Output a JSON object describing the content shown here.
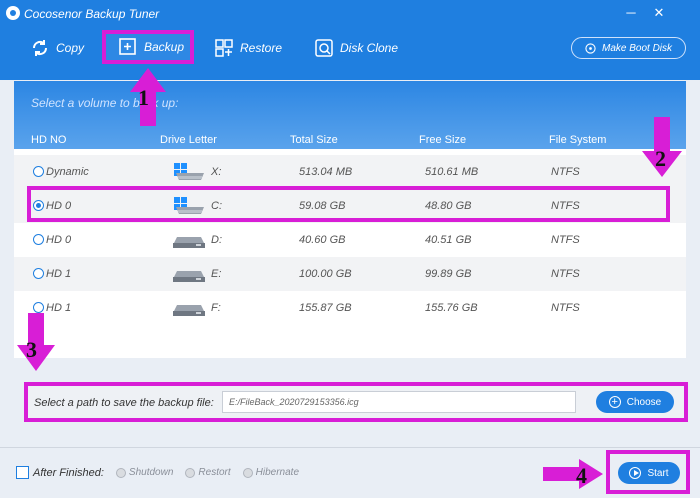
{
  "window": {
    "title": "Cocosenor Backup Tuner"
  },
  "toolbar": {
    "copy": "Copy",
    "backup": "Backup",
    "restore": "Restore",
    "disk_clone": "Disk Clone",
    "make_boot_disk": "Make Boot Disk"
  },
  "panel": {
    "hint": "Select a volume to back up:",
    "columns": [
      "HD NO",
      "Drive Letter",
      "Total Size",
      "Free Size",
      "File System"
    ],
    "rows": [
      {
        "hd": "Dynamic",
        "letter": "X:",
        "total": "513.04 MB",
        "free": "510.61 MB",
        "fs": "NTFS",
        "selected": false,
        "icon": "windows-drive-icon"
      },
      {
        "hd": "HD 0",
        "letter": "C:",
        "total": "59.08 GB",
        "free": "48.80 GB",
        "fs": "NTFS",
        "selected": true,
        "icon": "windows-drive-icon"
      },
      {
        "hd": "HD 0",
        "letter": "D:",
        "total": "40.60 GB",
        "free": "40.51 GB",
        "fs": "NTFS",
        "selected": false,
        "icon": "drive-icon"
      },
      {
        "hd": "HD 1",
        "letter": "E:",
        "total": "100.00 GB",
        "free": "99.89 GB",
        "fs": "NTFS",
        "selected": false,
        "icon": "drive-icon"
      },
      {
        "hd": "HD 1",
        "letter": "F:",
        "total": "155.87 GB",
        "free": "155.76 GB",
        "fs": "NTFS",
        "selected": false,
        "icon": "drive-icon"
      }
    ]
  },
  "path": {
    "label": "Select a path to save the backup file:",
    "value": "E:/FileBack_2020729153356.icg",
    "choose": "Choose"
  },
  "bottom": {
    "after_finished": "After Finished:",
    "options": [
      "Shutdown",
      "Restort",
      "Hibernate"
    ],
    "start": "Start"
  },
  "steps": [
    "1",
    "2",
    "3",
    "4"
  ],
  "colors": {
    "accent": "#1f7fe0",
    "annotation": "#d81ed6"
  }
}
